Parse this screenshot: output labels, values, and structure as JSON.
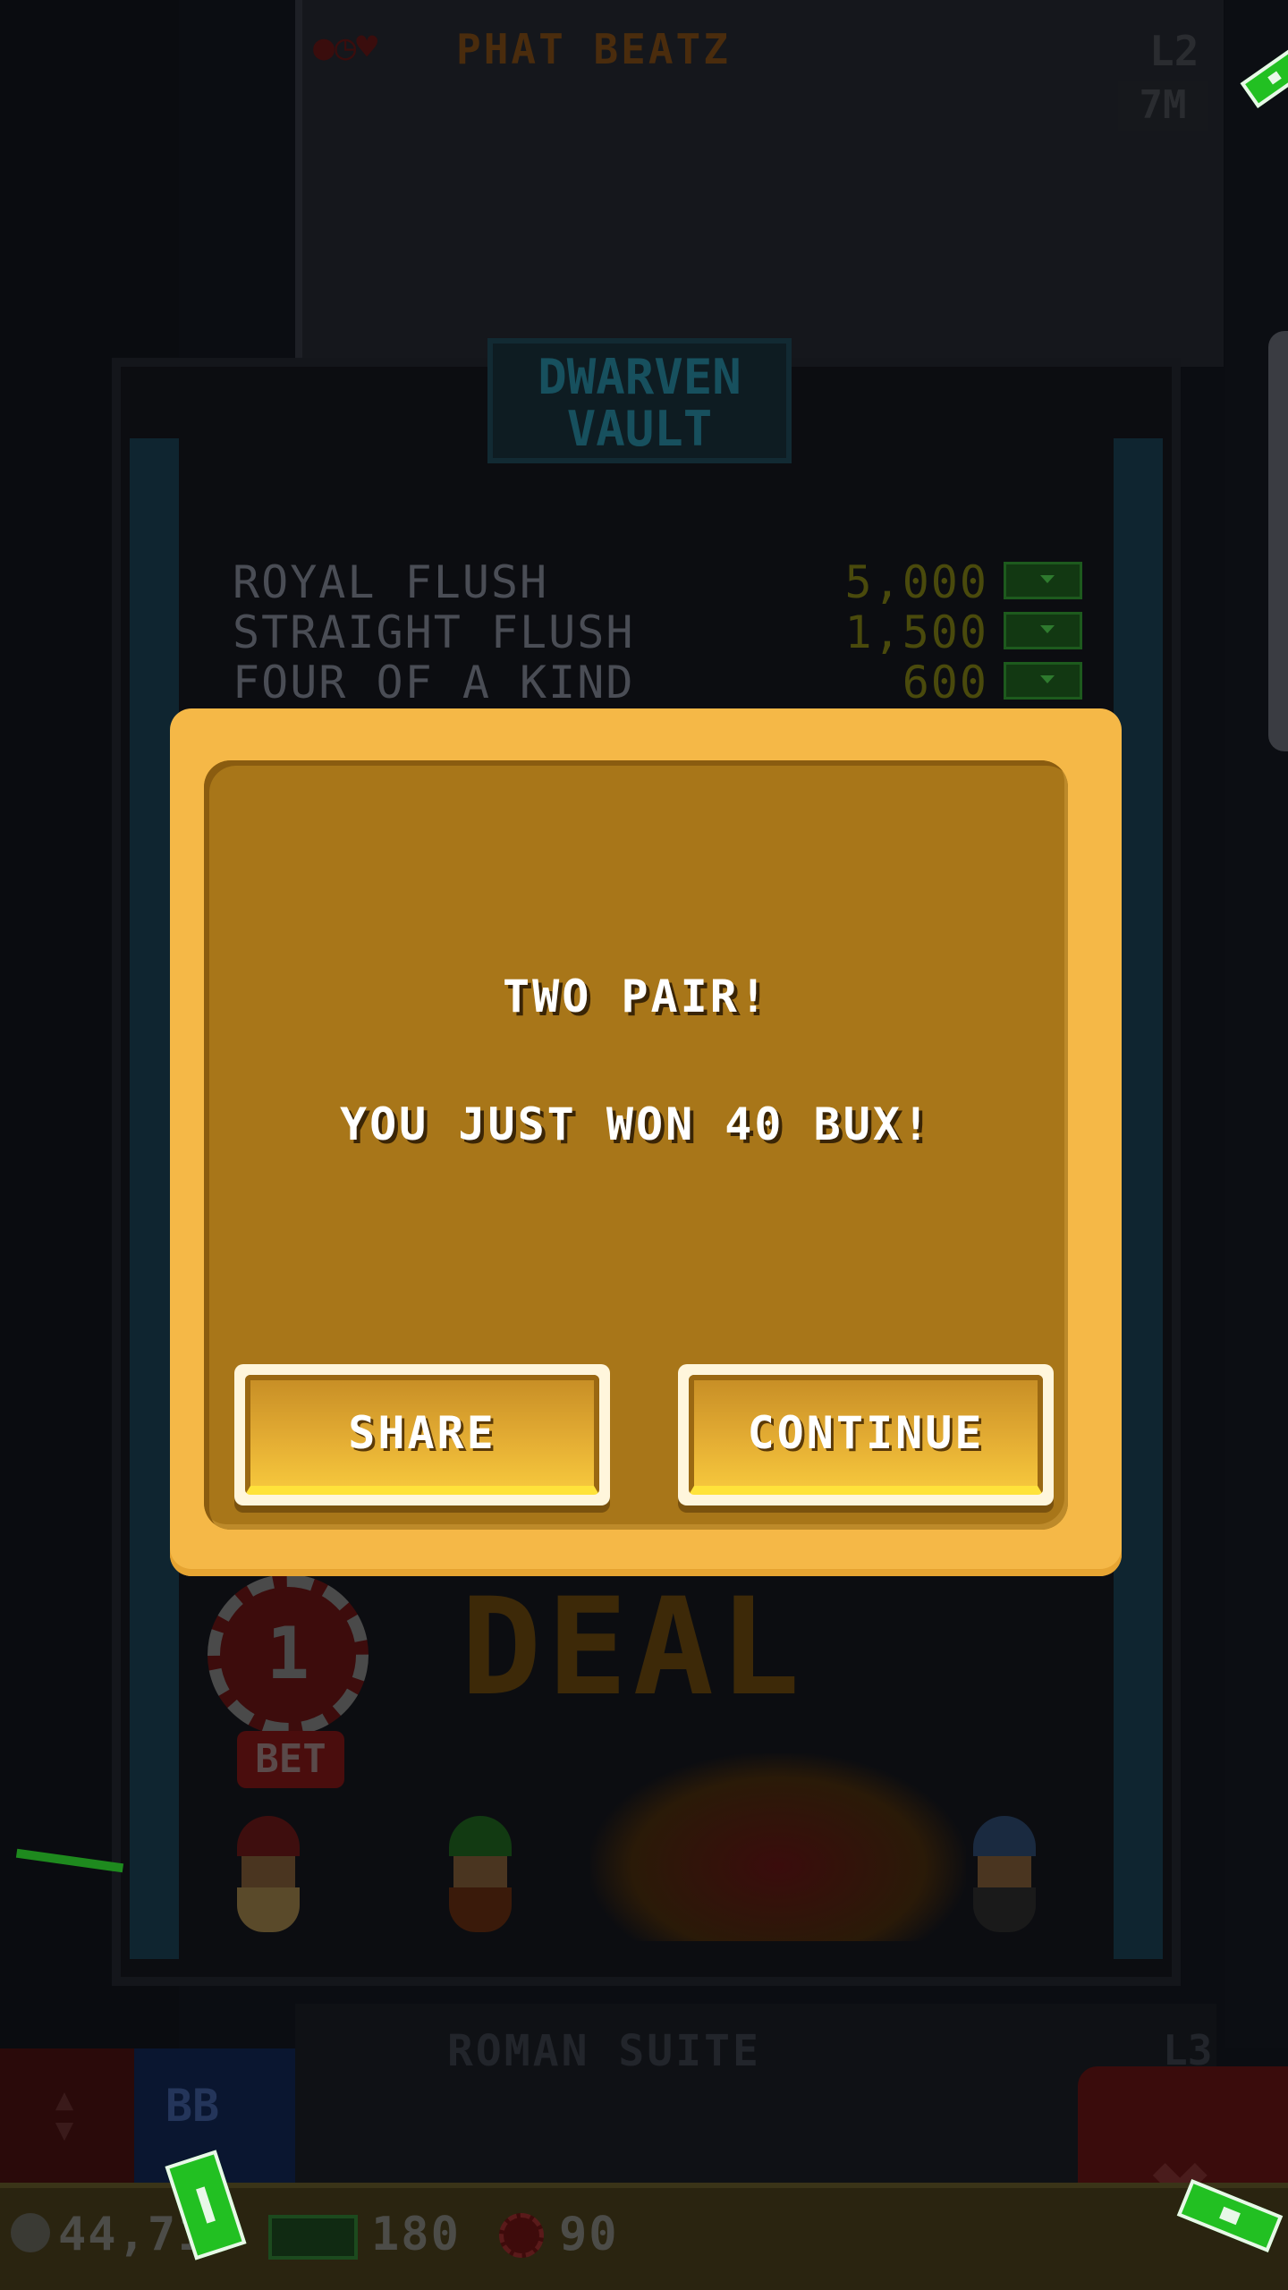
{
  "background": {
    "top_floor": {
      "title": "PHAT BEATZ",
      "level": "L2",
      "population": "7M"
    },
    "vault": {
      "sign_line1": "DWARVEN",
      "sign_line2": "VAULT",
      "paytable": [
        {
          "hand": "ROYAL FLUSH",
          "payout": "5,000"
        },
        {
          "hand": "STRAIGHT FLUSH",
          "payout": "1,500"
        },
        {
          "hand": "FOUR OF A KIND",
          "payout": "600"
        }
      ],
      "deal_label": "DEAL",
      "bet_chip_value": "1",
      "bet_label": "BET"
    },
    "bottom_floor": {
      "title": "ROMAN SUITE",
      "level": "L3"
    },
    "elevator_button_label": "BB"
  },
  "bottom_bar": {
    "coins": "44,71",
    "bux": "180",
    "chips": "90"
  },
  "dialog": {
    "title": "TWO PAIR!",
    "message": "YOU JUST WON 40 BUX!",
    "share_label": "SHARE",
    "continue_label": "CONTINUE"
  },
  "colors": {
    "dialog_outer": "#f5b847",
    "dialog_inner": "#a87619",
    "button_fill": "#e3ac33"
  }
}
